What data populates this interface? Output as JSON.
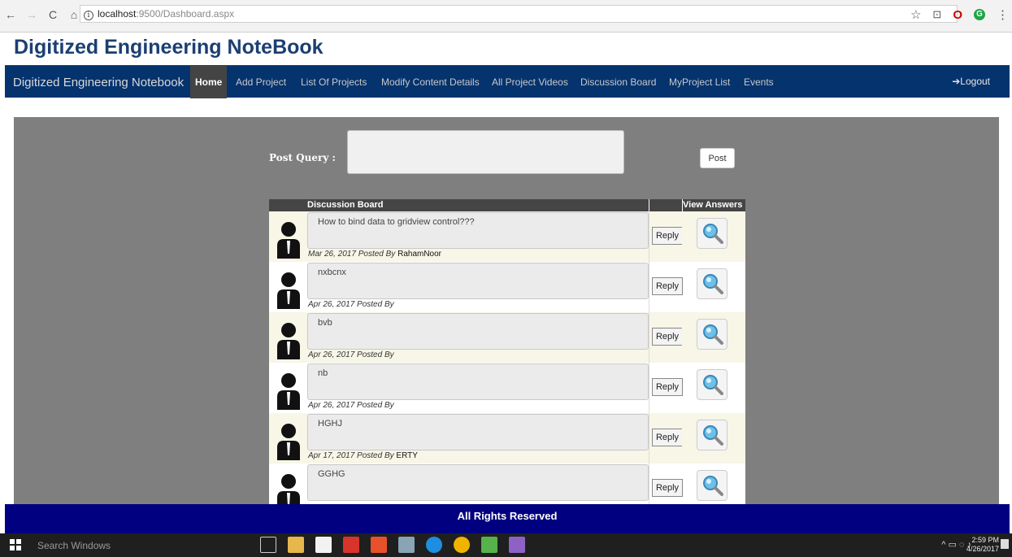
{
  "browser": {
    "back": "←",
    "forward": "→",
    "reload": "C",
    "home": "⌂",
    "info": "i",
    "url_host": "localhost",
    "url_path": ":9500/Dashboard.aspx",
    "star": "☆",
    "menu": "⋮"
  },
  "site_title": "Digitized Engineering NoteBook",
  "navbar": {
    "brand": "Digitized Engineering Notebook",
    "items": [
      {
        "label": "Home",
        "active": true
      },
      {
        "label": "Add Project"
      },
      {
        "label": "List Of Projects"
      },
      {
        "label": "Modify Content Details"
      },
      {
        "label": "All Project Videos"
      },
      {
        "label": "Discussion Board"
      },
      {
        "label": "MyProject List"
      },
      {
        "label": "Events"
      }
    ],
    "logout_icon": "➔",
    "logout": "Logout"
  },
  "post": {
    "label": "Post Query :",
    "value": "",
    "button": "Post"
  },
  "grid": {
    "header_title": "Discussion Board",
    "header_view": "View Answers",
    "rows": [
      {
        "message": "How to bind data to gridview control???",
        "date": "Mar 26, 2017",
        "posted_by_text": "Posted By",
        "author": "RahamNoor",
        "reply": "Reply"
      },
      {
        "message": "nxbcnx",
        "date": "Apr 26, 2017",
        "posted_by_text": "Posted By",
        "author": "",
        "reply": "Reply"
      },
      {
        "message": "bvb",
        "date": "Apr 26, 2017",
        "posted_by_text": "Posted By",
        "author": "",
        "reply": "Reply"
      },
      {
        "message": "nb",
        "date": "Apr 26, 2017",
        "posted_by_text": "Posted By",
        "author": "",
        "reply": "Reply"
      },
      {
        "message": "HGHJ",
        "date": "Apr 17, 2017",
        "posted_by_text": "Posted By",
        "author": "ERTY",
        "reply": "Reply"
      },
      {
        "message": "GGHG",
        "date": "",
        "posted_by_text": "",
        "author": "",
        "reply": "Reply"
      }
    ]
  },
  "footer": "All Rights Reserved",
  "taskbar": {
    "search": "Search Windows",
    "time": "2:59 PM",
    "date": "4/26/2017",
    "tray": "^ ▭ ◌ ♪"
  },
  "colors": {
    "navbar": "#05336e",
    "title": "#1c3f73",
    "panel": "#7f7f7f",
    "footer": "#000080"
  }
}
